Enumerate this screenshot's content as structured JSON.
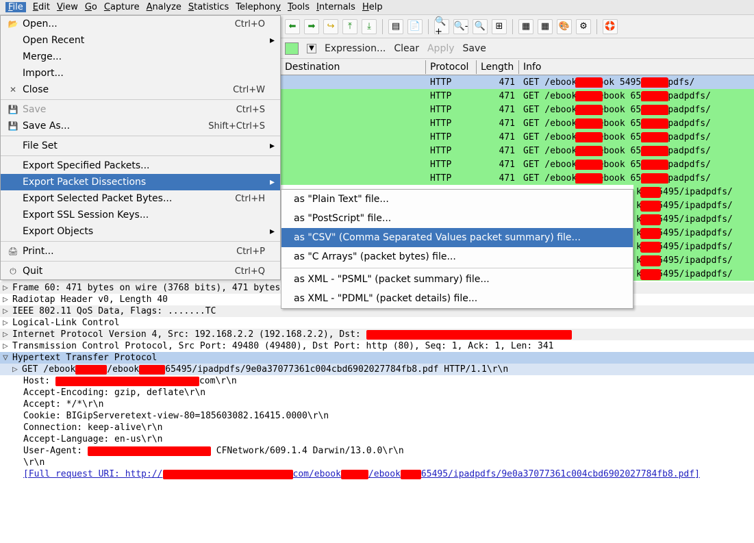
{
  "menubar": [
    "File",
    "Edit",
    "View",
    "Go",
    "Capture",
    "Analyze",
    "Statistics",
    "Telephony",
    "Tools",
    "Internals",
    "Help"
  ],
  "file_menu": [
    {
      "icon": "📂",
      "label": "Open...",
      "shortcut": "Ctrl+O",
      "sub": false
    },
    {
      "icon": "",
      "label": "Open Recent",
      "shortcut": "",
      "sub": true
    },
    {
      "icon": "",
      "label": "Merge...",
      "shortcut": "",
      "sub": false
    },
    {
      "icon": "",
      "label": "Import...",
      "shortcut": "",
      "sub": false
    },
    {
      "icon": "✕",
      "label": "Close",
      "shortcut": "Ctrl+W",
      "sub": false
    },
    {
      "sep": true
    },
    {
      "icon": "💾",
      "label": "Save",
      "shortcut": "Ctrl+S",
      "sub": false,
      "disabled": true
    },
    {
      "icon": "💾",
      "label": "Save As...",
      "shortcut": "Shift+Ctrl+S",
      "sub": false
    },
    {
      "sep": true
    },
    {
      "icon": "",
      "label": "File Set",
      "shortcut": "",
      "sub": true
    },
    {
      "sep": true
    },
    {
      "icon": "",
      "label": "Export Specified Packets...",
      "shortcut": "",
      "sub": false
    },
    {
      "icon": "",
      "label": "Export Packet Dissections",
      "shortcut": "",
      "sub": true,
      "hl": true
    },
    {
      "icon": "",
      "label": "Export Selected Packet Bytes...",
      "shortcut": "Ctrl+H",
      "sub": false
    },
    {
      "icon": "",
      "label": "Export SSL Session Keys...",
      "shortcut": "",
      "sub": false
    },
    {
      "icon": "",
      "label": "Export Objects",
      "shortcut": "",
      "sub": true
    },
    {
      "sep": true
    },
    {
      "icon": "🖨",
      "label": "Print...",
      "shortcut": "Ctrl+P",
      "sub": false
    },
    {
      "sep": true
    },
    {
      "icon": "⏻",
      "label": "Quit",
      "shortcut": "Ctrl+Q",
      "sub": false
    }
  ],
  "submenu": [
    {
      "label": "as \"Plain Text\" file..."
    },
    {
      "label": "as \"PostScript\" file..."
    },
    {
      "label": "as \"CSV\" (Comma Separated Values packet summary) file...",
      "hl": true
    },
    {
      "label": "as \"C Arrays\" (packet bytes) file..."
    },
    {
      "sep": true
    },
    {
      "label": "as XML - \"PSML\" (packet summary) file..."
    },
    {
      "label": "as XML - \"PDML\" (packet details) file..."
    }
  ],
  "filter": {
    "expression": "Expression...",
    "clear": "Clear",
    "apply": "Apply",
    "save": "Save"
  },
  "columns": {
    "dest": "Destination",
    "proto": "Protocol",
    "len": "Length",
    "info": "Info"
  },
  "rows": [
    {
      "sel": true,
      "proto": "HTTP",
      "len": "471",
      "info": "GET  /ebook        /ebook       5495/ipadpdfs/"
    },
    {
      "proto": "HTTP",
      "len": "471",
      "info": "GET  /ebooka      s/ebook      65495/ipadpdfs/"
    },
    {
      "proto": "HTTP",
      "len": "471",
      "info": "GET  /ebooka      s/ebook      65495/ipadpdfs/"
    },
    {
      "proto": "HTTP",
      "len": "471",
      "info": "GET  /ebooka      s/ebook      65495/ipadpdfs/"
    },
    {
      "proto": "HTTP",
      "len": "471",
      "info": "GET  /ebooka      s/ebook      65495/ipadpdfs/"
    },
    {
      "proto": "HTTP",
      "len": "471",
      "info": "GET  /ebooka      s/ebook      65495/ipadpdfs/"
    },
    {
      "proto": "HTTP",
      "len": "471",
      "info": "GET  /ebooka      s/ebook      65495/ipadpdfs/"
    },
    {
      "proto": "HTTP",
      "len": "471",
      "info": "GET  /ebooka      s/ebook      65495/ipadpdfs/"
    }
  ],
  "hidden_rows_text": [
    "k    765495/ipadpdfs/",
    "k    765495/ipadpdfs/",
    "k    765495/ipadpdfs/",
    "k    765495/ipadpdfs/",
    "k    765495/ipadpdfs/",
    "k    765495/ipadpdfs/",
    "k    765495/ipadpdfs/"
  ],
  "tree": {
    "l0": "Frame 60: 471 bytes on wire (3768 bits), 471 bytes captured (3768 bits)",
    "l1": "Radiotap Header v0, Length 40",
    "l2": "IEEE 802.11 QoS Data, Flags: .......TC",
    "l3": "Logical-Link Control",
    "l4a": "Internet Protocol Version 4, Src: 192.168.2.2 (192.168.2.2), Dst: ",
    "l5": "Transmission Control Protocol, Src Port: 49480 (49480), Dst Port: http (80), Seq: 1, Ack: 1, Len: 341",
    "l6": "Hypertext Transfer Protocol",
    "l7a": "GET  /ebook",
    "l7b": "/ebook",
    "l7c": "65495/ipadpdfs/9e0a37077361c004cbd6902027784fb8.pdf  HTTP/1.1\\r\\n",
    "l8a": "Host: ",
    "l8b": "com\\r\\n",
    "l9": "Accept-Encoding: gzip, deflate\\r\\n",
    "l10": "Accept: */*\\r\\n",
    "l11": "Cookie: BIGipServeretext-view-80=185603082.16415.0000\\r\\n",
    "l12": "Connection: keep-alive\\r\\n",
    "l13": "Accept-Language: en-us\\r\\n",
    "l14a": "User-Agent: ",
    "l14b": " CFNetwork/609.1.4 Darwin/13.0.0\\r\\n",
    "l15": "\\r\\n",
    "l16a": "[Full request URI: http://",
    "l16b": "com/ebook",
    "l16c": "/ebook",
    "l16d": "65495/ipadpdfs/9e0a37077361c004cbd6902027784fb8.pdf]"
  }
}
